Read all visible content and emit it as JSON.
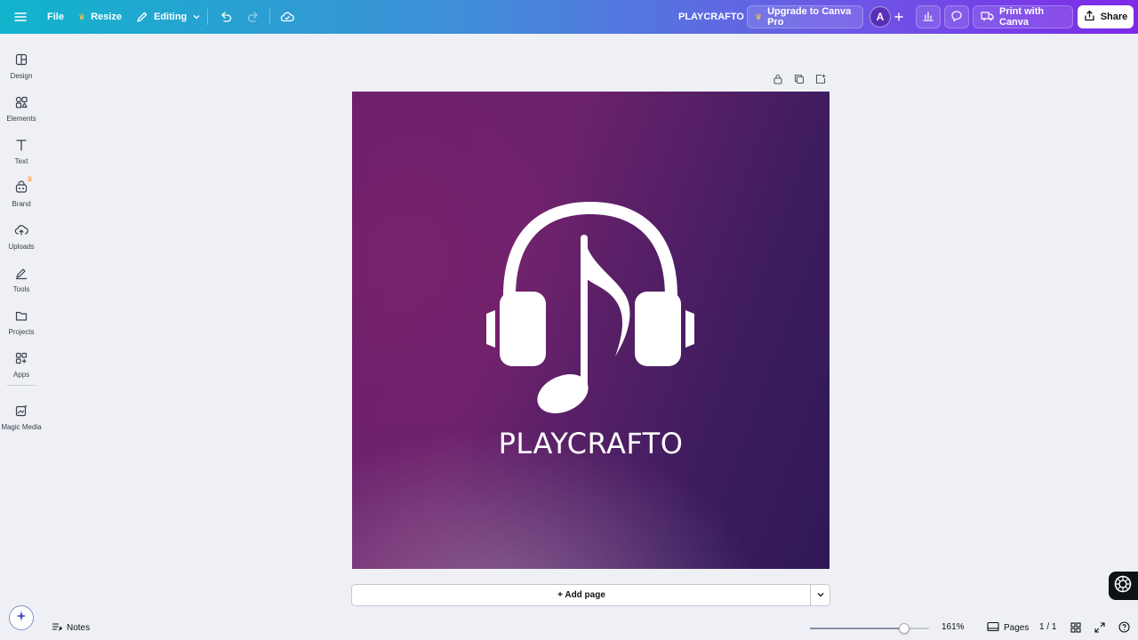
{
  "topbar": {
    "menu_icon": "hamburger-icon",
    "file_label": "File",
    "resize_label": "Resize",
    "editing_label": "Editing",
    "doc_title": "PLAYCRAFTO",
    "upgrade_label": "Upgrade to Canva Pro",
    "avatar_initial": "A",
    "print_label": "Print with Canva",
    "share_label": "Share",
    "accent_colors": [
      "#11b4cc",
      "#7d2ae8"
    ]
  },
  "sidebar": {
    "items": [
      {
        "label": "Design",
        "icon": "design-icon"
      },
      {
        "label": "Elements",
        "icon": "elements-icon"
      },
      {
        "label": "Text",
        "icon": "text-icon"
      },
      {
        "label": "Brand",
        "icon": "brand-icon"
      },
      {
        "label": "Uploads",
        "icon": "uploads-icon"
      },
      {
        "label": "Tools",
        "icon": "tools-icon"
      },
      {
        "label": "Projects",
        "icon": "projects-icon"
      },
      {
        "label": "Apps",
        "icon": "apps-icon"
      },
      {
        "label": "Magic Media",
        "icon": "magic-media-icon"
      }
    ]
  },
  "canvas": {
    "logo_text": "PLAYCRAFTO",
    "graphic": "headphones-music-note",
    "background_colors": [
      "#6b1f6b",
      "#2f1855"
    ]
  },
  "add_page_label": "+ Add page",
  "bottombar": {
    "notes_label": "Notes",
    "zoom_value": 161,
    "zoom_label": "161%",
    "pages_label": "Pages",
    "page_count": "1 / 1"
  }
}
